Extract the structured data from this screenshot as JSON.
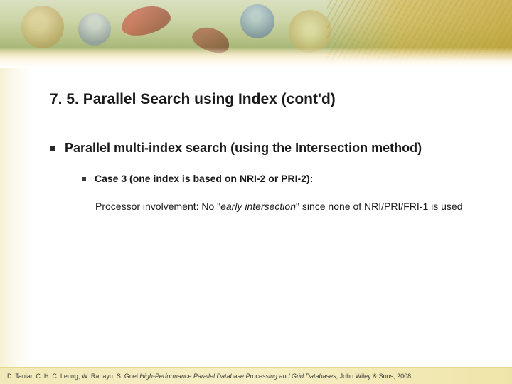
{
  "slide": {
    "title": "7. 5. Parallel Search using Index (cont'd)",
    "bullet1": "Parallel multi-index search (using the Intersection method)",
    "bullet2": "Case 3 (one index is based on NRI-2 or PRI-2):",
    "body_prefix": " Processor involvement: No \"",
    "body_italic": "early intersection",
    "body_suffix": "\" since none of NRI/PRI/FRI-1 is used"
  },
  "footer": {
    "authors": "D. Taniar, C. H. C. Leung, W. Rahayu, S. Goel: ",
    "book": "High-Performance Parallel Database Processing and Grid Databases",
    "publisher": ", John Wiley & Sons, 2008"
  }
}
